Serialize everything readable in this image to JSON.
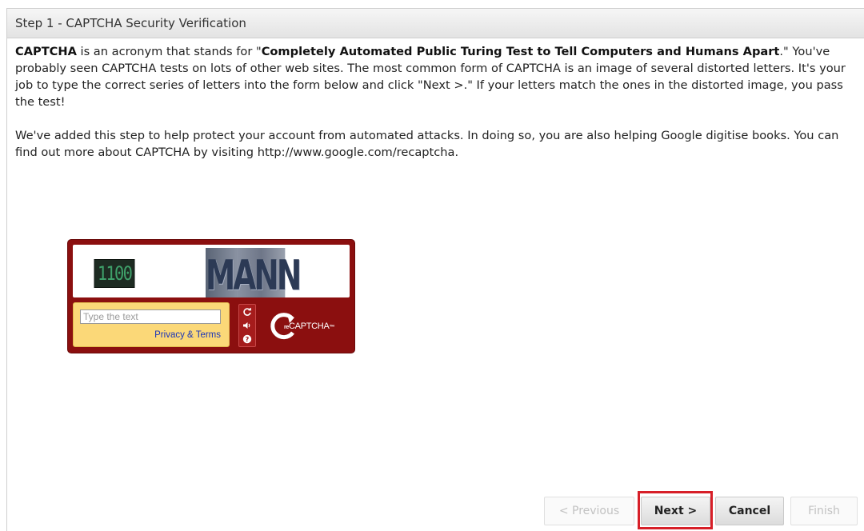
{
  "header": {
    "title": "Step 1 - CAPTCHA Security Verification"
  },
  "intro": {
    "p1_lead": "CAPTCHA",
    "p1_mid": " is an acronym that stands for \"",
    "p1_expansion": "Completely Automated Public Turing Test to Tell Computers and Humans Apart",
    "p1_rest": ".\" You've probably seen CAPTCHA tests on lots of other web sites. The most common form of CAPTCHA is an image of several distorted letters. It's your job to type the correct series of letters into the form below and click \"Next >.\" If your letters match the ones in the distorted image, you pass the test!",
    "p2": "We've added this step to help protect your account from automated attacks. In doing so, you are also helping Google digitise books. You can find out more about CAPTCHA by visiting http://www.google.com/recaptcha."
  },
  "recaptcha": {
    "word1": "1100",
    "word2": "MANN",
    "input_placeholder": "Type the text",
    "input_value": "",
    "privacy_link": "Privacy & Terms",
    "logo_prefix": "re",
    "logo_text": "CAPTCHA",
    "logo_tm": "™",
    "colors": {
      "frame": "#8b0f0f",
      "input_area": "#fbd878",
      "link": "#1a34b8"
    }
  },
  "buttons": {
    "previous": "< Previous",
    "next": "Next >",
    "cancel": "Cancel",
    "finish": "Finish",
    "highlight_color": "#d71f28"
  }
}
